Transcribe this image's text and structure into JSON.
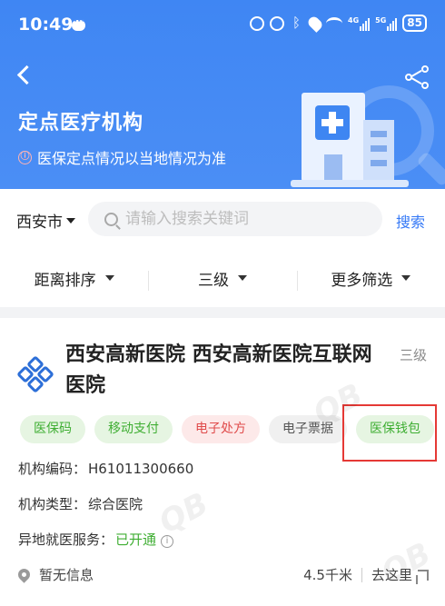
{
  "status_bar": {
    "time": "10:49",
    "signal1_label": "4G",
    "signal2_label": "5G",
    "battery": "85"
  },
  "header": {
    "title": "定点医疗机构",
    "notice": "医保定点情况以当地情况为准",
    "notice_icon": "ⓘ"
  },
  "search": {
    "city": "西安市",
    "placeholder": "请输入搜索关键词",
    "button": "搜索"
  },
  "filters": [
    {
      "label": "距离排序"
    },
    {
      "label": "三级"
    },
    {
      "label": "更多筛选"
    }
  ],
  "card": {
    "name": "西安高新医院 西安高新医院互联网医院",
    "level": "三级",
    "tags": [
      {
        "label": "医保码",
        "style": "green"
      },
      {
        "label": "移动支付",
        "style": "green"
      },
      {
        "label": "电子处方",
        "style": "red"
      },
      {
        "label": "电子票据",
        "style": "gray"
      },
      {
        "label": "医保钱包",
        "style": "green"
      }
    ],
    "code_label": "机构编码：",
    "code_value": "H61011300660",
    "type_label": "机构类型：",
    "type_value": "综合医院",
    "remote_label": "异地就医服务：",
    "remote_value": "已开通",
    "address": "暂无信息",
    "distance": "4.5千米",
    "goto": "去这里"
  },
  "colors": {
    "header_blue": "#4b8ef5",
    "link_blue": "#3478f6",
    "tag_green": "#3fae33",
    "tag_red": "#e04b4b",
    "highlight_red": "#e53935"
  }
}
